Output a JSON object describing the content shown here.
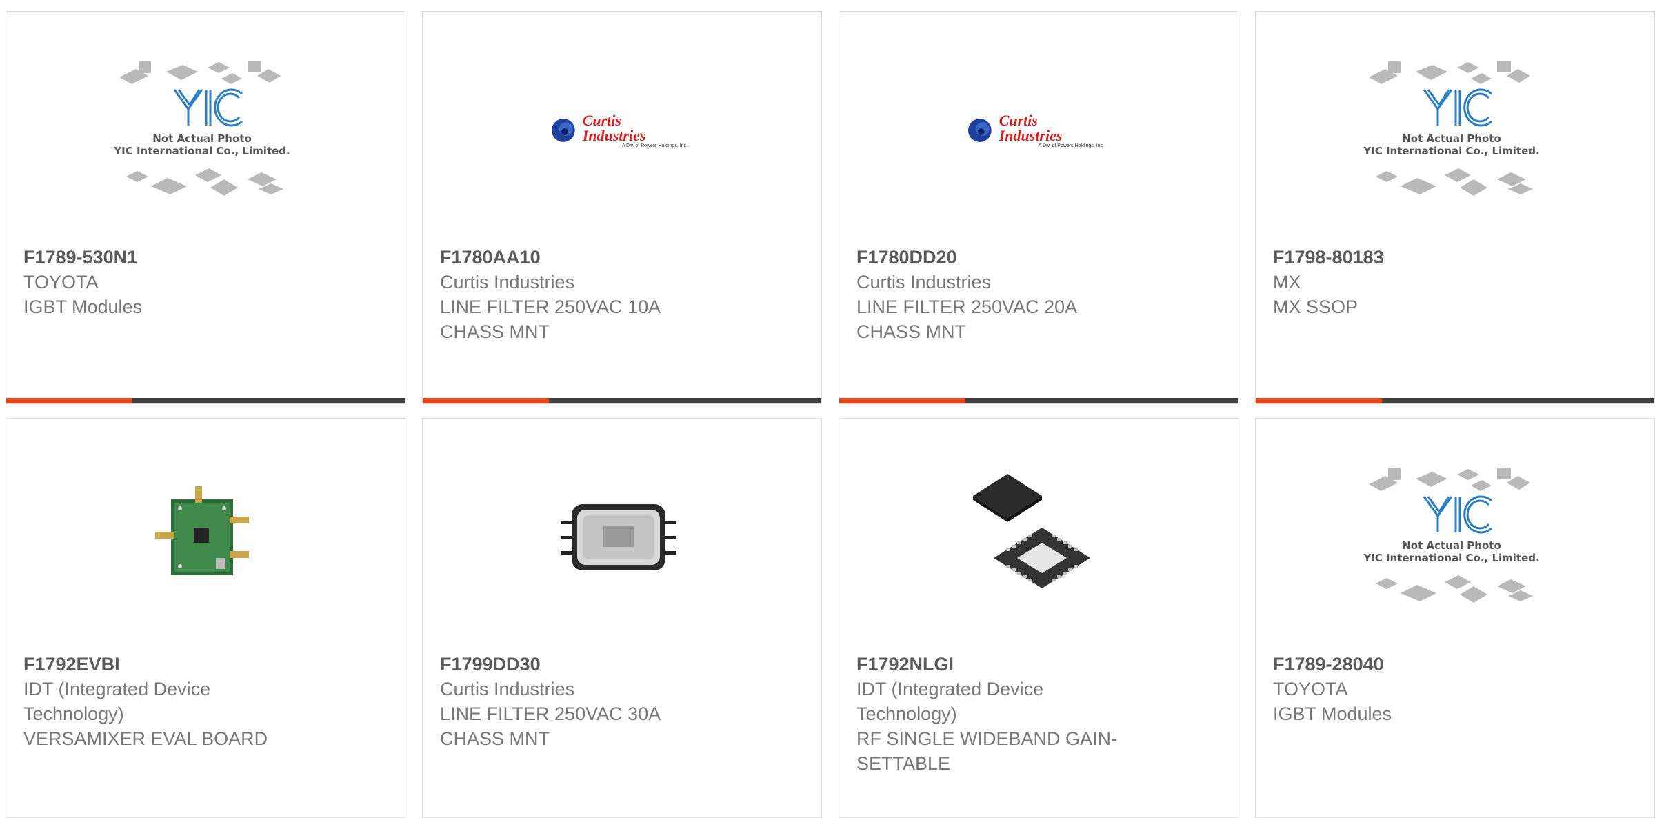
{
  "products": [
    {
      "part": "F1789-530N1",
      "manufacturer": "TOYOTA",
      "description": "IGBT Modules",
      "image": "yic-placeholder-icon"
    },
    {
      "part": "F1780AA10",
      "manufacturer": "Curtis Industries",
      "description": "LINE FILTER 250VAC 10A CHASS MNT",
      "image": "curtis-logo-icon"
    },
    {
      "part": "F1780DD20",
      "manufacturer": "Curtis Industries",
      "description": "LINE FILTER 250VAC 20A CHASS MNT",
      "image": "curtis-logo-icon"
    },
    {
      "part": "F1798-80183",
      "manufacturer": "MX",
      "description": "MX SSOP",
      "image": "yic-placeholder-icon"
    },
    {
      "part": "F1792EVBI",
      "manufacturer": "IDT (Integrated Device Technology)",
      "description": "VERSAMIXER EVAL BOARD",
      "image": "eval-board-icon"
    },
    {
      "part": "F1799DD30",
      "manufacturer": "Curtis Industries",
      "description": "LINE FILTER 250VAC 30A CHASS MNT",
      "image": "line-filter-icon"
    },
    {
      "part": "F1792NLGI",
      "manufacturer": "IDT (Integrated Device Technology)",
      "description": "RF SINGLE WIDEBAND GAIN-SETTABLE",
      "image": "qfn-chip-icon"
    },
    {
      "part": "F1789-28040",
      "manufacturer": "TOYOTA",
      "description": "IGBT Modules",
      "image": "yic-placeholder-icon"
    }
  ],
  "placeholder": {
    "line1": "Not Actual Photo",
    "line2": "YIC International Co., Limited.",
    "logo_text": "YIC"
  },
  "curtis_logo": {
    "name": "Curtis Industries",
    "tagline": "A Div. of Powers Holdings, Inc."
  },
  "colors": {
    "accent": "#e8441a",
    "bar": "#404040",
    "border": "#d9d9d9",
    "curtis_red": "#d61f1f",
    "curtis_blue": "#1f3f9a",
    "yic_blue": "#2a7fc4"
  }
}
